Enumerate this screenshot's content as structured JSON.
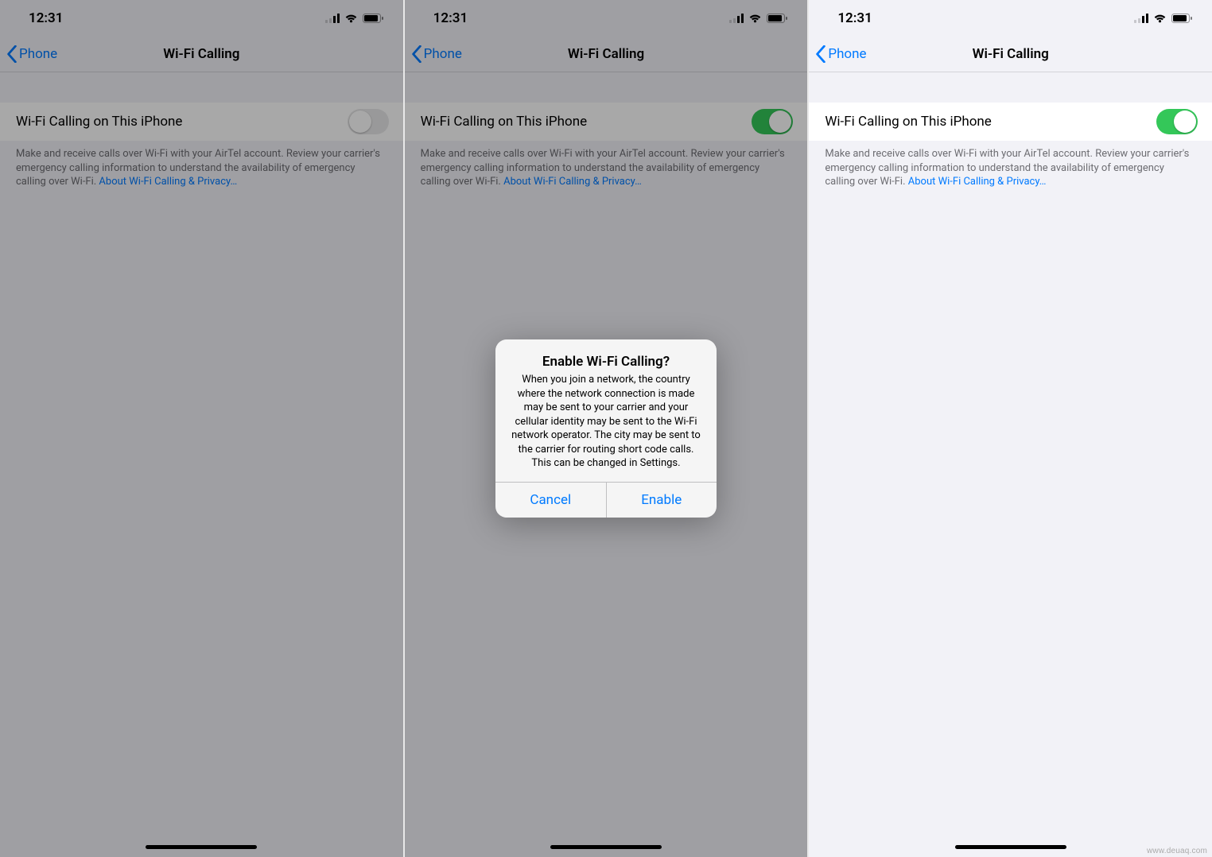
{
  "statusbar": {
    "time": "12:31"
  },
  "nav": {
    "back_label": "Phone",
    "title": "Wi-Fi Calling"
  },
  "row": {
    "label": "Wi-Fi Calling on This iPhone"
  },
  "footer": {
    "text": "Make and receive calls over Wi-Fi with your AirTel account. Review your carrier's emergency calling information to understand the availability of emergency calling over Wi-Fi.",
    "link": "About Wi-Fi Calling & Privacy…"
  },
  "alert": {
    "title": "Enable Wi-Fi Calling?",
    "message": "When you join a network, the country where the network connection is made may be sent to your carrier and your cellular identity may be sent to the Wi-Fi network operator. The city may be sent to the carrier for routing short code calls. This can be changed in Settings.",
    "cancel": "Cancel",
    "confirm": "Enable"
  },
  "screens": {
    "s1": {
      "switch_on": false,
      "dimmed": true,
      "show_alert": false
    },
    "s2": {
      "switch_on": true,
      "dimmed": false,
      "show_alert": true
    },
    "s3": {
      "switch_on": true,
      "dimmed": false,
      "show_alert": false
    }
  },
  "watermark": "www.deuaq.com"
}
